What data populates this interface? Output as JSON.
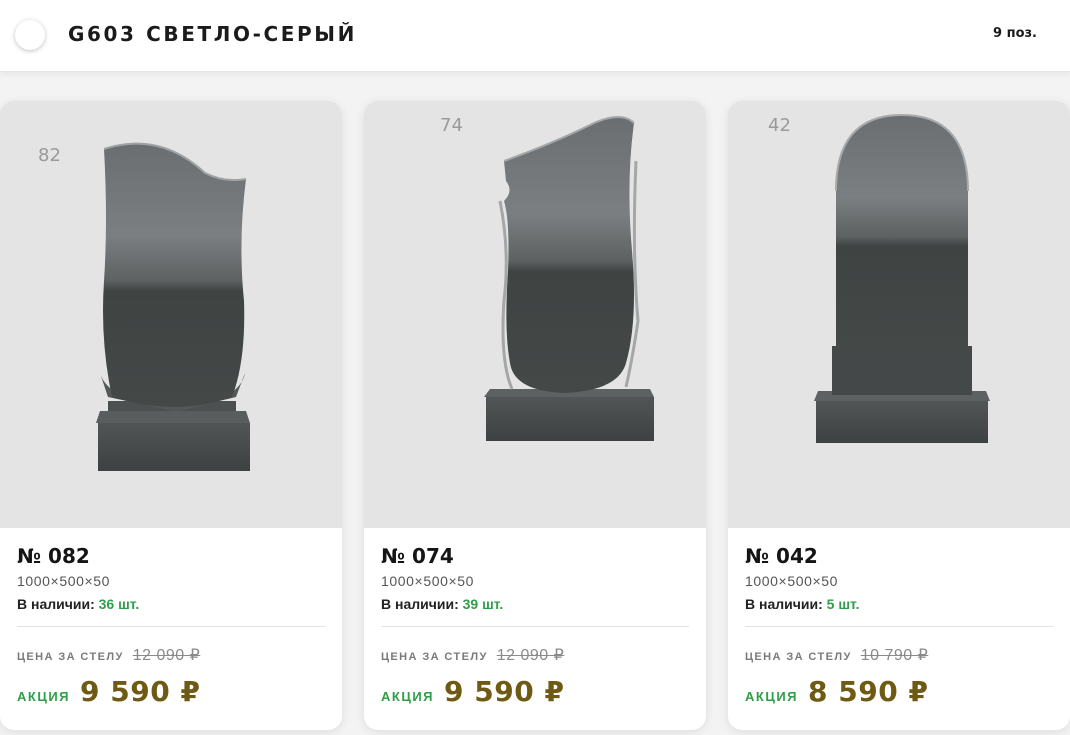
{
  "header": {
    "title": "G603 СВЕТЛО-СЕРЫЙ",
    "count": "9 поз."
  },
  "products": [
    {
      "image_label": "82",
      "name": "№ 082",
      "size": "1000×500×50",
      "stock_label": "В наличии:",
      "stock_value": "36 шт.",
      "old_label": "ЦЕНА ЗА СТЕЛУ",
      "old_price": "12 090 ₽",
      "promo_label": "АКЦИЯ",
      "promo_price": "9 590 ₽"
    },
    {
      "image_label": "74",
      "name": "№ 074",
      "size": "1000×500×50",
      "stock_label": "В наличии:",
      "stock_value": "39 шт.",
      "old_label": "ЦЕНА ЗА СТЕЛУ",
      "old_price": "12 090 ₽",
      "promo_label": "АКЦИЯ",
      "promo_price": "9 590 ₽"
    },
    {
      "image_label": "42",
      "name": "№ 042",
      "size": "1000×500×50",
      "stock_label": "В наличии:",
      "stock_value": "5 шт.",
      "old_label": "ЦЕНА ЗА СТЕЛУ",
      "old_price": "10 790 ₽",
      "promo_label": "АКЦИЯ",
      "promo_price": "8 590 ₽"
    }
  ],
  "colors": {
    "accent_green": "#2e9e48",
    "price_brown": "#6e5a12",
    "granite_dark": "#4a4d4d"
  }
}
